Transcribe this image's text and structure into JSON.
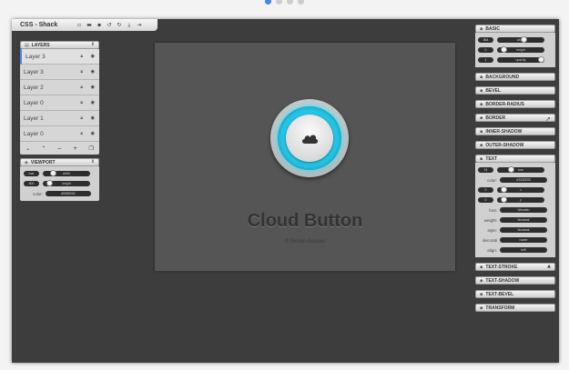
{
  "app": {
    "title": "CSS - Shack",
    "toolbar_icons": [
      "new-file-icon",
      "open-folder-icon",
      "save-icon",
      "undo-icon",
      "redo-icon",
      "download-icon",
      "export-icon"
    ]
  },
  "layers_panel": {
    "title": "LAYERS",
    "layers": [
      {
        "label": "Layer 3",
        "selected": true
      },
      {
        "label": "Layer 3",
        "selected": false
      },
      {
        "label": "Layer 2",
        "selected": false
      },
      {
        "label": "Layer 0",
        "selected": false
      },
      {
        "label": "Layer 1",
        "selected": false
      },
      {
        "label": "Layer 0",
        "selected": false
      }
    ]
  },
  "viewport_panel": {
    "title": "VIEWPORT",
    "width_value": "mar",
    "width_label": "width",
    "height_value": "500",
    "height_label": "height",
    "color_label": "color:",
    "color_value": "#555252"
  },
  "canvas": {
    "title": "Cloud Button",
    "subtitle": "© Simon Goucer",
    "accent": "#27c6e6"
  },
  "properties": {
    "basic": {
      "title": "BASIC",
      "width_value": "364",
      "width_label": "width",
      "height_value": "0",
      "height_label": "height",
      "opacity_value": "1",
      "opacity_label": "opacity"
    },
    "sections_a": [
      "BACKGROUND",
      "BEVEL",
      "BORDER-RADIUS",
      "BORDER",
      "INNER-SHADOW",
      "OUTER-SHADOW"
    ],
    "text": {
      "title": "TEXT",
      "size_value": "24",
      "size_label": "size",
      "color_label": "color:",
      "color_value": "#333333",
      "x_value": "0",
      "x_label": "x",
      "y_value": "0",
      "y_label": "y",
      "font_label": "font:",
      "font_value": "Ubuntu",
      "weight_label": "weight:",
      "weight_value": "Normal",
      "style_label": "style:",
      "style_value": "Normal",
      "decoration_label": "decorati",
      "decoration_value": "none",
      "align_label": "align:",
      "align_value": "left"
    },
    "sections_b": [
      "TEXT-STROKE",
      "TEXT-SHADOW",
      "TEXT-BEVEL",
      "TRANSFORM"
    ]
  }
}
